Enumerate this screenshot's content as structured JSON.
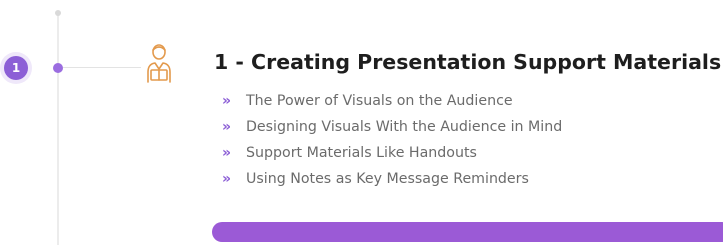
{
  "step": {
    "number": "1"
  },
  "section": {
    "title": "1 - Creating Presentation Support Materials",
    "icon": "presenter-icon",
    "bullet_glyph": "»"
  },
  "lessons": [
    "The Power of Visuals on the Audience",
    "Designing Visuals With the Audience in Mind",
    "Support Materials Like Handouts",
    "Using Notes as Key Message Reminders"
  ],
  "colors": {
    "accent": "#8c5fd6",
    "bar": "#9b5ad6",
    "title": "#1e1e1e",
    "lesson_text": "#6b6b6b",
    "icon": "#e39a4d"
  }
}
